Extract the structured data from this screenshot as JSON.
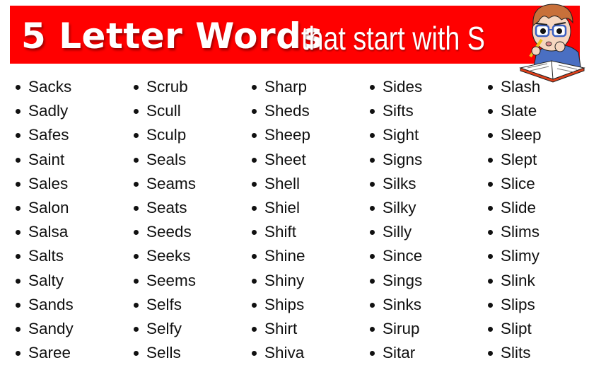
{
  "header": {
    "title_bold": "5 Letter Words",
    "title_light": "that start with S",
    "banner_color": "#ff0000",
    "mascot": "student-reading-book-illustration"
  },
  "columns": [
    [
      "Sacks",
      "Sadly",
      "Safes",
      "Saint",
      "Sales",
      "Salon",
      "Salsa",
      "Salts",
      "Salty",
      "Sands",
      "Sandy",
      "Saree"
    ],
    [
      "Scrub",
      "Scull",
      "Sculp",
      "Seals",
      "Seams",
      "Seats",
      "Seeds",
      "Seeks",
      "Seems",
      "Selfs",
      "Selfy",
      "Sells"
    ],
    [
      "Sharp",
      "Sheds",
      "Sheep",
      "Sheet",
      "Shell",
      "Shiel",
      "Shift",
      "Shine",
      "Shiny",
      "Ships",
      "Shirt",
      "Shiva"
    ],
    [
      "Sides",
      "Sifts",
      "Sight",
      "Signs",
      "Silks",
      "Silky",
      "Silly",
      "Since",
      "Sings",
      "Sinks",
      "Sirup",
      "Sitar"
    ],
    [
      "Slash",
      "Slate",
      "Sleep",
      "Slept",
      "Slice",
      "Slide",
      "Slims",
      "Slimy",
      "Slink",
      "Slips",
      "Slipt",
      "Slits"
    ]
  ]
}
